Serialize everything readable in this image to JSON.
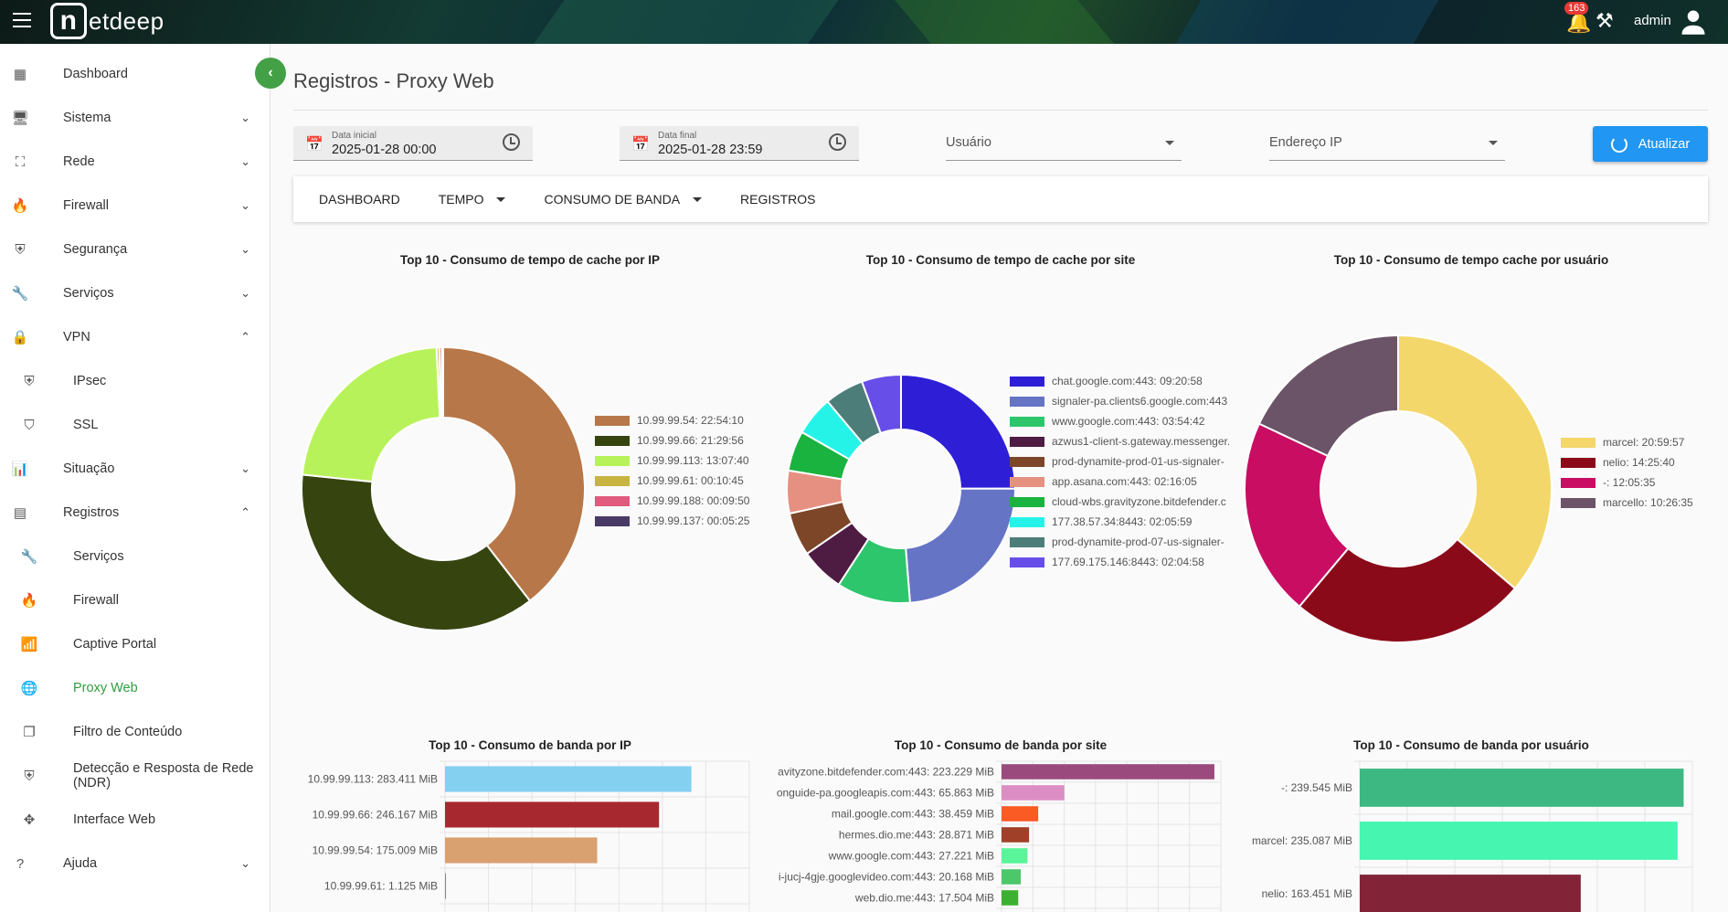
{
  "header": {
    "logo": "netdeep",
    "notifications": "163",
    "user": "admin"
  },
  "sidebar": {
    "items": [
      {
        "label": "Dashboard",
        "icon": "grid-icon"
      },
      {
        "label": "Sistema",
        "icon": "monitor-icon",
        "chevron": "down"
      },
      {
        "label": "Rede",
        "icon": "network-icon",
        "chevron": "down"
      },
      {
        "label": "Firewall",
        "icon": "flame-icon",
        "chevron": "down"
      },
      {
        "label": "Segurança",
        "icon": "shield-icon",
        "chevron": "down"
      },
      {
        "label": "Serviços",
        "icon": "wrench-icon",
        "chevron": "down"
      },
      {
        "label": "VPN",
        "icon": "lock-icon",
        "chevron": "up"
      },
      {
        "label": "IPsec",
        "icon": "shield-icon",
        "sub": true
      },
      {
        "label": "SSL",
        "icon": "shield-outline-icon",
        "sub": true
      },
      {
        "label": "Situação",
        "icon": "bar-chart-icon",
        "chevron": "down"
      },
      {
        "label": "Registros",
        "icon": "list-icon",
        "chevron": "up"
      },
      {
        "label": "Serviços",
        "icon": "wrench-icon",
        "sub": true
      },
      {
        "label": "Firewall",
        "icon": "flame-icon",
        "sub": true
      },
      {
        "label": "Captive Portal",
        "icon": "wifi-icon",
        "sub": true
      },
      {
        "label": "Proxy Web",
        "icon": "globe-icon",
        "sub": true,
        "active": true
      },
      {
        "label": "Filtro de Conteúdo",
        "icon": "filter-icon",
        "sub": true
      },
      {
        "label": "Detecção e Resposta de Rede (NDR)",
        "icon": "shield-check-icon",
        "sub": true
      },
      {
        "label": "Interface Web",
        "icon": "move-icon",
        "sub": true
      },
      {
        "label": "Ajuda",
        "icon": "help-icon",
        "chevron": "down"
      }
    ]
  },
  "page": {
    "title": "Registros - Proxy Web"
  },
  "filters": {
    "start_label": "Data inicial",
    "start_value": "2025-01-28 00:00",
    "end_label": "Data final",
    "end_value": "2025-01-28 23:59",
    "user_label": "Usuário",
    "ip_label": "Endereço IP",
    "refresh": "Atualizar"
  },
  "tabs": [
    {
      "label": "DASHBOARD"
    },
    {
      "label": "TEMPO",
      "dropdown": true
    },
    {
      "label": "CONSUMO DE BANDA",
      "dropdown": true
    },
    {
      "label": "REGISTROS"
    }
  ],
  "accent": "#43a047",
  "chart_data": [
    {
      "type": "pie",
      "title": "Top 10 - Consumo de tempo de cache por IP",
      "labels": [
        "10.99.99.54: 22:54:10",
        "10.99.99.66: 21:29:56",
        "10.99.99.113: 13:07:40",
        "10.99.99.61: 00:10:45",
        "10.99.99.188: 00:09:50",
        "10.99.99.137: 00:05:25"
      ],
      "values": [
        "22:54:10",
        "21:29:56",
        "13:07:40",
        "00:10:45",
        "00:09:50",
        "00:05:25"
      ],
      "colors": [
        "#b87748",
        "#36450f",
        "#b8f25a",
        "#c8b440",
        "#e05a7e",
        "#4a3a66"
      ]
    },
    {
      "type": "pie",
      "title": "Top 10 - Consumo de tempo de cache por site",
      "labels": [
        "chat.google.com:443: 09:20:58",
        "signaler-pa.clients6.google.com:443",
        "www.google.com:443: 03:54:42",
        "azwus1-client-s.gateway.messenger.",
        "prod-dynamite-prod-01-us-signaler-",
        "app.asana.com:443: 02:16:05",
        "cloud-wbs.gravityzone.bitdefender.c",
        "177.38.57.34:8443: 02:05:59",
        "prod-dynamite-prod-07-us-signaler-",
        "177.69.175.146:8443: 02:04:58"
      ],
      "values": [
        "09:20:58",
        "08:55:00",
        "03:54:42",
        "02:20:00",
        "02:18:00",
        "02:16:05",
        "02:08:00",
        "02:05:59",
        "02:05:00",
        "02:04:58"
      ],
      "colors": [
        "#2e1fd6",
        "#6674c6",
        "#2ec66c",
        "#4e1b42",
        "#7d4629",
        "#e69081",
        "#1bb33f",
        "#26f3e8",
        "#4d7d78",
        "#684ee8"
      ]
    },
    {
      "type": "pie",
      "title": "Top 10 - Consumo de tempo cache por usuário",
      "labels": [
        "marcel: 20:59:57",
        "nelio: 14:25:40",
        "-: 12:05:35",
        "marcello: 10:26:35"
      ],
      "values": [
        "20:59:57",
        "14:25:40",
        "12:05:35",
        "10:26:35"
      ],
      "colors": [
        "#f3d76a",
        "#8b0a19",
        "#c90d63",
        "#6b5467"
      ]
    },
    {
      "type": "bar",
      "orientation": "horizontal",
      "title": "Top 10 - Consumo de banda por IP",
      "categories": [
        "10.99.99.113: 283.411 MiB",
        "10.99.99.66: 246.167 MiB",
        "10.99.99.54: 175.009 MiB",
        "10.99.99.61: 1.125 MiB"
      ],
      "values": [
        283.411,
        246.167,
        175.009,
        1.125
      ],
      "xlim": [
        0,
        350
      ],
      "grid": true,
      "colors": [
        "#84d0f0",
        "#a8282f",
        "#d9a070",
        "#888888"
      ]
    },
    {
      "type": "bar",
      "orientation": "horizontal",
      "title": "Top 10 - Consumo de banda por site",
      "categories": [
        "avityzone.bitdefender.com:443: 223.229 MiB",
        "onguide-pa.googleapis.com:443: 65.863 MiB",
        "mail.google.com:443: 38.459 MiB",
        "hermes.dio.me:443: 28.871 MiB",
        "www.google.com:443: 27.221 MiB",
        "i-jucj-4gje.googlevideo.com:443: 20.168 MiB",
        "web.dio.me:443: 17.504 MiB"
      ],
      "values": [
        223.229,
        65.863,
        38.459,
        28.871,
        27.221,
        20.168,
        17.504
      ],
      "xlim": [
        0,
        230
      ],
      "grid": true,
      "colors": [
        "#9b4a7e",
        "#dc8ec4",
        "#fa5a24",
        "#a04028",
        "#5af59a",
        "#4bc86a",
        "#3cb030"
      ]
    },
    {
      "type": "bar",
      "orientation": "horizontal",
      "title": "Top 10 - Consumo de banda por usuário",
      "categories": [
        "-: 239.545 MiB",
        "marcel: 235.087 MiB",
        "nelio: 163.451 MiB"
      ],
      "values": [
        239.545,
        235.087,
        163.451
      ],
      "xlim": [
        0,
        246
      ],
      "grid": true,
      "colors": [
        "#3db883",
        "#45f5b0",
        "#832337"
      ]
    }
  ]
}
